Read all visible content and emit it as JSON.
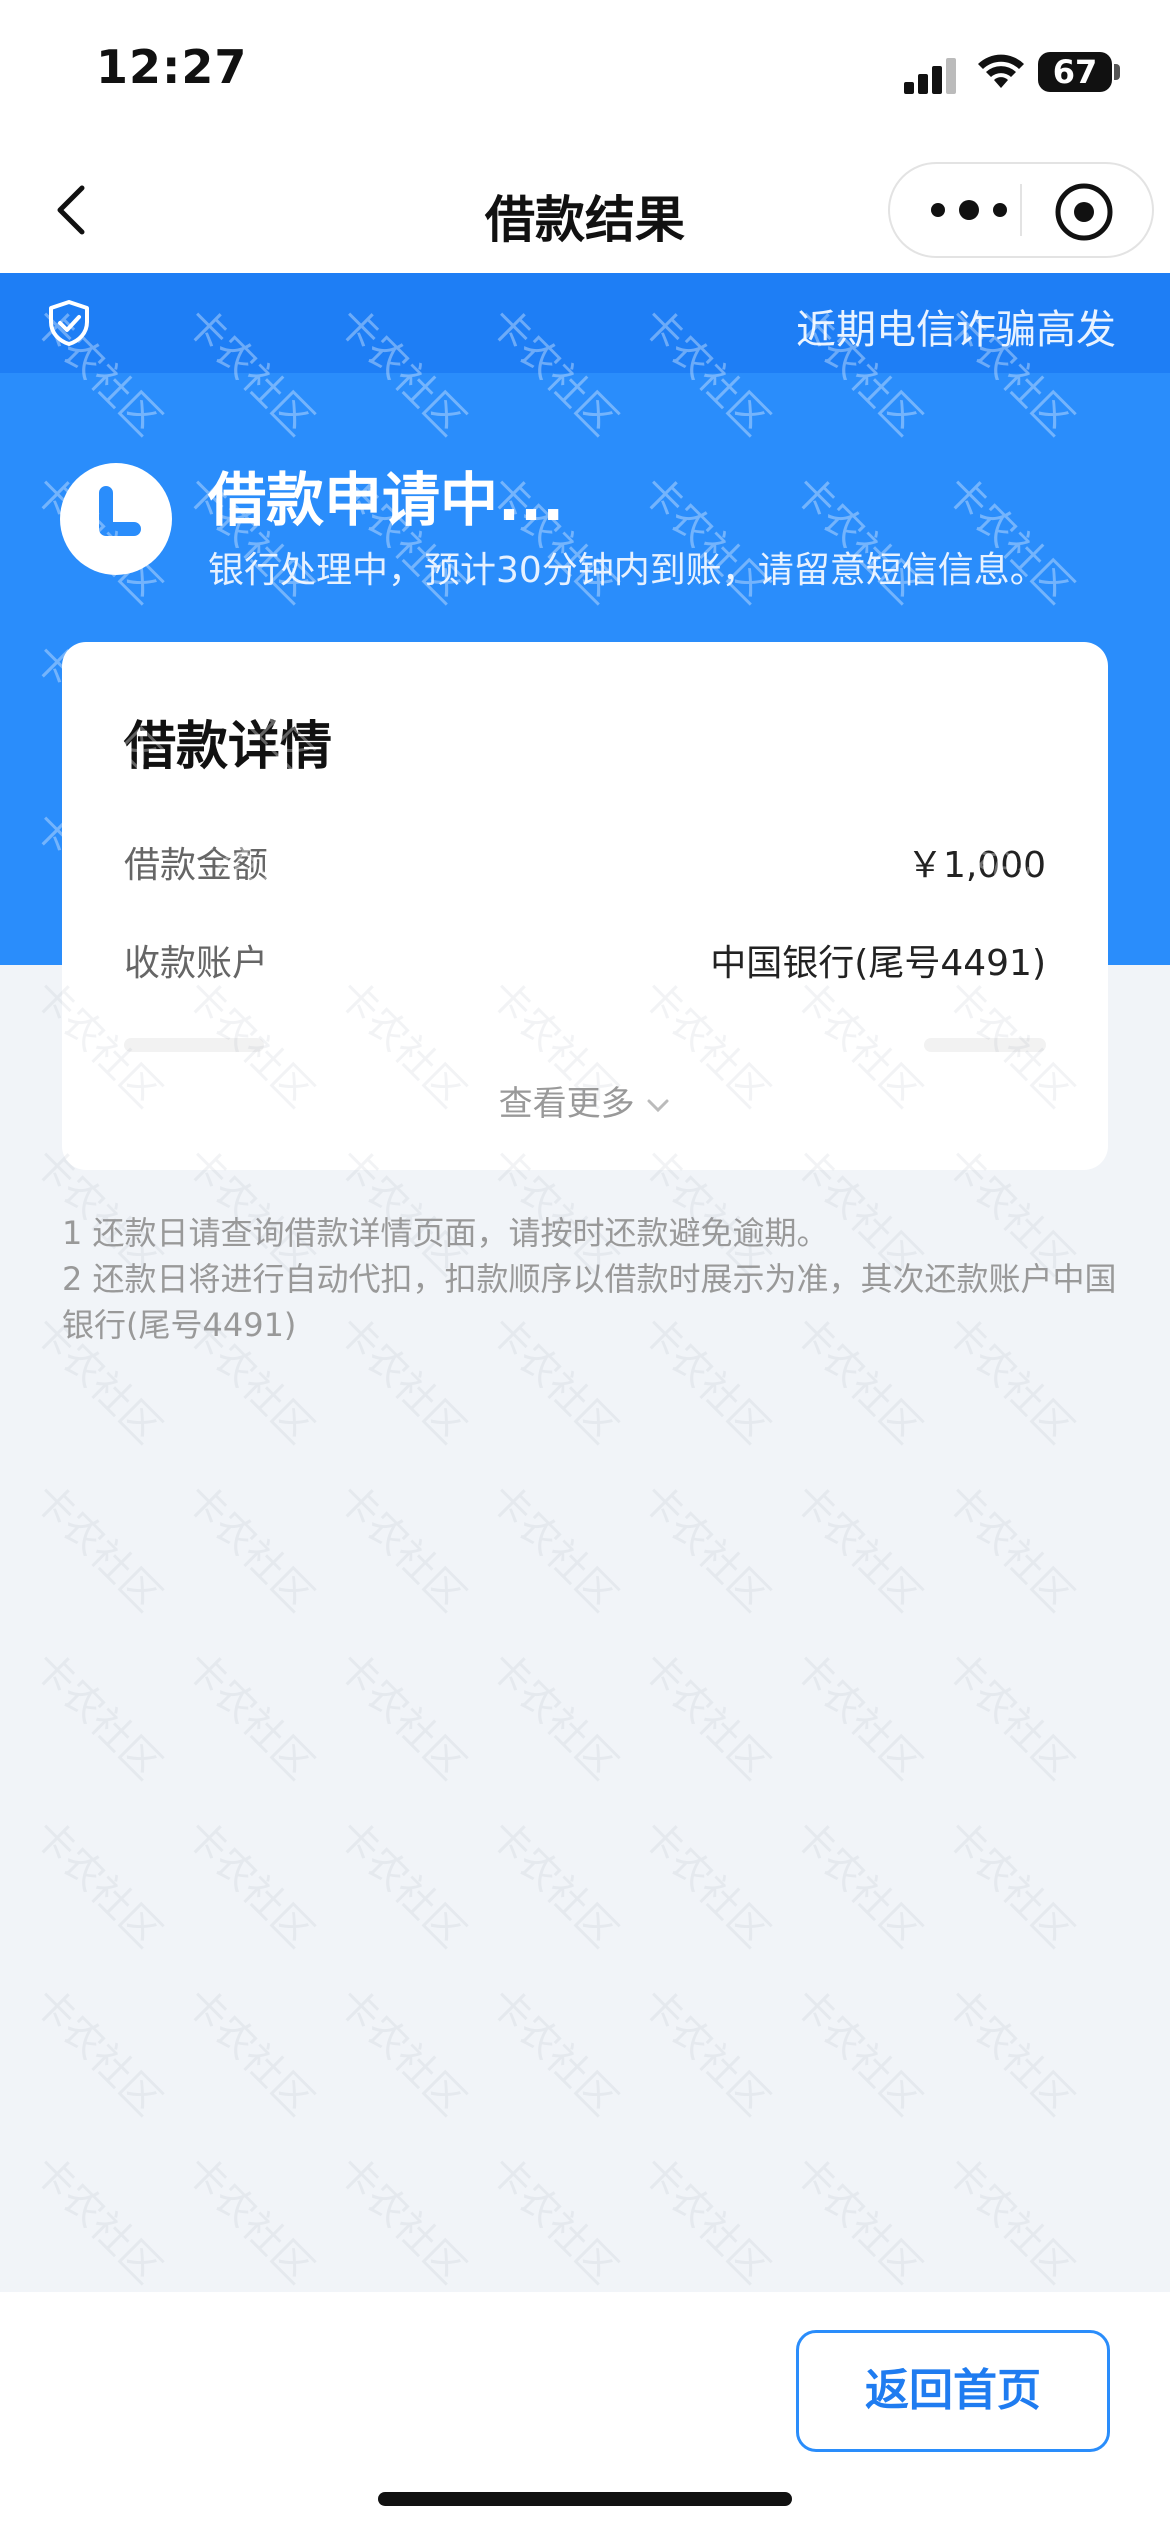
{
  "status_bar": {
    "time": "12:27",
    "battery": "67"
  },
  "nav": {
    "title": "借款结果"
  },
  "notice": {
    "text": "近期电信诈骗高发"
  },
  "status": {
    "title": "借款申请中...",
    "subtitle": "银行处理中，预计30分钟内到账，请留意短信信息。"
  },
  "card": {
    "title": "借款详情",
    "rows": [
      {
        "label": "借款金额",
        "value": "￥1,000"
      },
      {
        "label": "收款账户",
        "value": "中国银行(尾号4491)"
      }
    ],
    "view_more": "查看更多"
  },
  "notes": {
    "line1": "1 还款日请查询借款详情页面，请按时还款避免逾期。",
    "line2": "2 还款日将进行自动代扣，扣款顺序以借款时展示为准，其次还款账户中国银行(尾号4491)"
  },
  "watermark": "卡农社区",
  "footer": {
    "home_button": "返回首页"
  },
  "colors": {
    "primary": "#2a8dfb",
    "background": "#f1f4f8"
  }
}
